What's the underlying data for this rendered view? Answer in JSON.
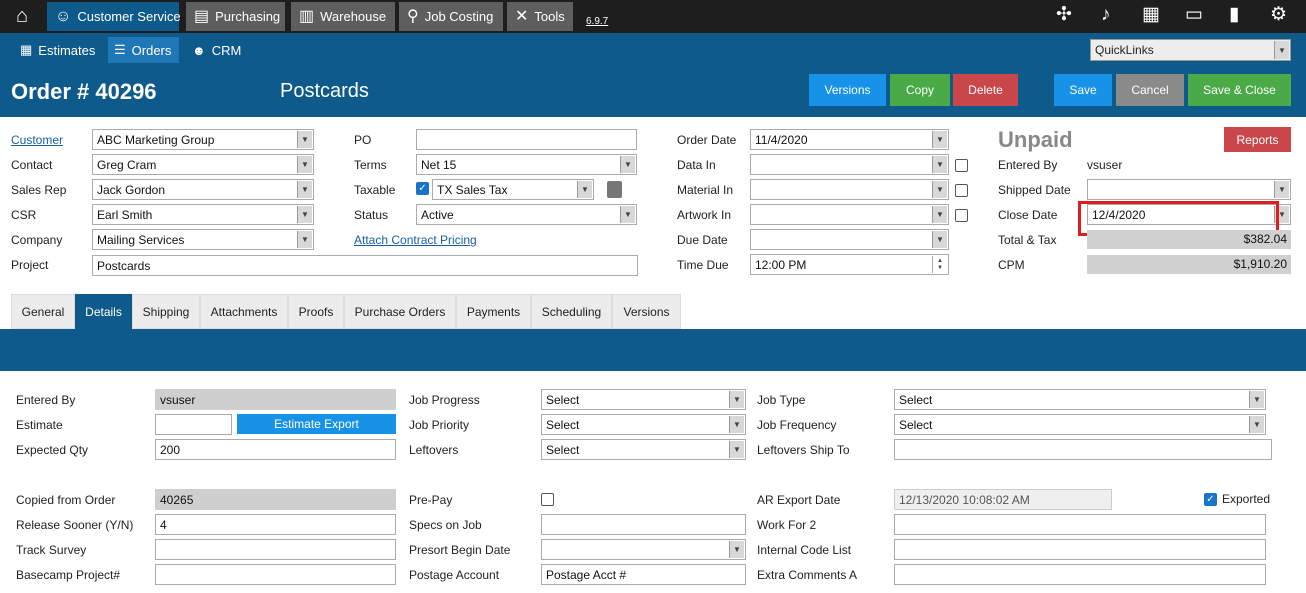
{
  "topnav": {
    "items": [
      {
        "label": "Customer Service",
        "icon": "headset-icon"
      },
      {
        "label": "Purchasing",
        "icon": "cart-icon"
      },
      {
        "label": "Warehouse",
        "icon": "forklift-icon"
      },
      {
        "label": "Job Costing",
        "icon": "magnifier-icon"
      },
      {
        "label": "Tools",
        "icon": "tools-icon"
      }
    ],
    "version": "6.9.7"
  },
  "subnav": {
    "items": [
      {
        "label": "Estimates",
        "icon": "calculator-icon"
      },
      {
        "label": "Orders",
        "icon": "list-icon"
      },
      {
        "label": "CRM",
        "icon": "people-icon"
      }
    ],
    "quicklinks": "QuickLinks"
  },
  "order": {
    "title": "Order # 40296",
    "name": "Postcards",
    "buttons": {
      "versions": "Versions",
      "copy": "Copy",
      "delete": "Delete",
      "save": "Save",
      "cancel": "Cancel",
      "save_close": "Save & Close"
    }
  },
  "form": {
    "customer_label": "Customer",
    "customer": "ABC Marketing Group",
    "contact_label": "Contact",
    "contact": "Greg Cram",
    "salesrep_label": "Sales Rep",
    "salesrep": "Jack Gordon",
    "csr_label": "CSR",
    "csr": "Earl Smith",
    "company_label": "Company",
    "company": "Mailing Services",
    "project_label": "Project",
    "project": "Postcards",
    "po_label": "PO",
    "po": "",
    "terms_label": "Terms",
    "terms": "Net 15",
    "taxable_label": "Taxable",
    "taxable": "TX Sales Tax",
    "status_label": "Status",
    "status": "Active",
    "contract_link": "Attach Contract Pricing",
    "orderdate_label": "Order Date",
    "orderdate": "11/4/2020",
    "datain_label": "Data In",
    "datain": "",
    "materialin_label": "Material In",
    "materialin": "",
    "artworkin_label": "Artwork In",
    "artworkin": "",
    "duedate_label": "Due Date",
    "duedate": "",
    "timedue_label": "Time Due",
    "timedue": "12:00 PM",
    "paystatus": "Unpaid",
    "reports": "Reports",
    "enteredby_label": "Entered By",
    "enteredby": "vsuser",
    "shipped_label": "Shipped Date",
    "shipped": "",
    "close_label": "Close Date",
    "close": "12/4/2020",
    "total_label": "Total & Tax",
    "total": "$382.04",
    "cpm_label": "CPM",
    "cpm": "$1,910.20"
  },
  "tabs": [
    "General",
    "Details",
    "Shipping",
    "Attachments",
    "Proofs",
    "Purchase Orders",
    "Payments",
    "Scheduling",
    "Versions"
  ],
  "details": {
    "enteredby_label": "Entered By",
    "enteredby": "vsuser",
    "estimate_label": "Estimate",
    "estimate": "",
    "estimate_export": "Estimate Export",
    "expqty_label": "Expected Qty",
    "expqty": "200",
    "copied_label": "Copied from Order",
    "copied": "40265",
    "release_label": "Release Sooner (Y/N)",
    "release": "4",
    "track_label": "Track Survey",
    "track": "",
    "basecamp_label": "Basecamp Project#",
    "basecamp": "",
    "jobprogress_label": "Job Progress",
    "jobprogress": "Select",
    "jobpriority_label": "Job Priority",
    "jobpriority": "Select",
    "leftovers_label": "Leftovers",
    "leftovers": "Select",
    "prepay_label": "Pre-Pay",
    "specs_label": "Specs on Job",
    "specs": "",
    "presort_label": "Presort Begin Date",
    "presort": "",
    "postage_label": "Postage Account",
    "postage": "Postage Acct #",
    "jobtype_label": "Job Type",
    "jobtype": "Select",
    "jobfreq_label": "Job Frequency",
    "jobfreq": "Select",
    "leftship_label": "Leftovers Ship To",
    "leftship": "",
    "arexport_label": "AR Export Date",
    "arexport": "12/13/2020 10:08:02 AM",
    "exported_label": "Exported",
    "workfor_label": "Work For 2",
    "workfor": "",
    "internal_label": "Internal Code List",
    "internal": "",
    "extra_label": "Extra Comments A",
    "extra": ""
  }
}
